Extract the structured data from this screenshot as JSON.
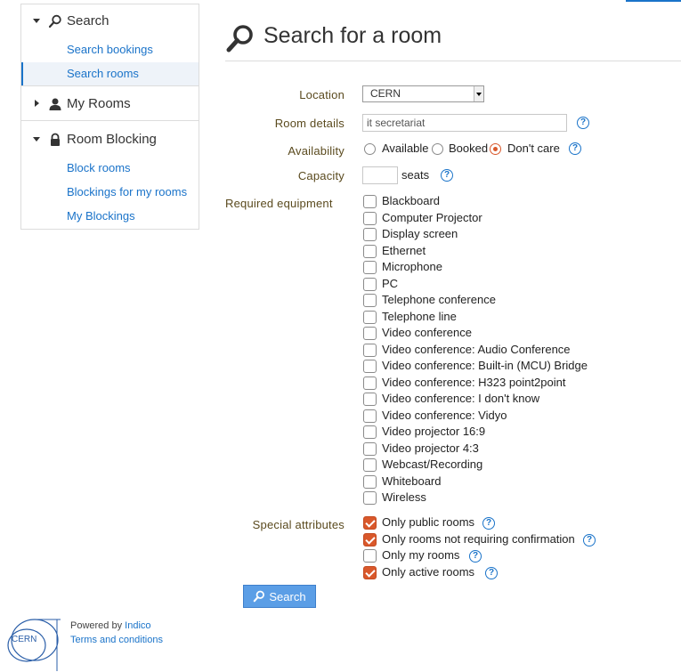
{
  "sidebar": {
    "search": {
      "title": "Search",
      "links": [
        "Search bookings",
        "Search rooms"
      ]
    },
    "my_rooms": {
      "title": "My Rooms"
    },
    "room_blocking": {
      "title": "Room Blocking",
      "links": [
        "Block rooms",
        "Blockings for my rooms",
        "My Blockings"
      ]
    }
  },
  "page": {
    "title": "Search for a room"
  },
  "form": {
    "location_label": "Location",
    "location_value": "CERN",
    "room_details_label": "Room details",
    "room_details_value": "it secretariat",
    "availability_label": "Availability",
    "availability_options": [
      "Available",
      "Booked",
      "Don't care"
    ],
    "availability_selected": "Don't care",
    "capacity_label": "Capacity",
    "capacity_value": "",
    "capacity_unit": "seats",
    "equipment_label": "Required equipment",
    "equipment": [
      "Blackboard",
      "Computer Projector",
      "Display screen",
      "Ethernet",
      "Microphone",
      "PC",
      "Telephone conference",
      "Telephone line",
      "Video conference",
      "Video conference: Audio Conference",
      "Video conference: Built-in (MCU) Bridge",
      "Video conference: H323 point2point",
      "Video conference: I don't know",
      "Video conference: Vidyo",
      "Video projector 16:9",
      "Video projector 4:3",
      "Webcast/Recording",
      "Whiteboard",
      "Wireless"
    ],
    "special_label": "Special attributes",
    "special": [
      {
        "label": "Only public rooms",
        "checked": true
      },
      {
        "label": "Only rooms not requiring confirmation",
        "checked": true
      },
      {
        "label": "Only my rooms",
        "checked": false
      },
      {
        "label": "Only active rooms",
        "checked": true
      }
    ],
    "help_glyph": "?",
    "search_button": "Search"
  },
  "footer": {
    "logo_text": "CERN",
    "powered_prefix": "Powered by",
    "powered_link": "Indico",
    "terms": "Terms and conditions"
  },
  "colors": {
    "accent": "#1a73c9",
    "checked": "#d9582b",
    "button": "#5b9ee6"
  }
}
